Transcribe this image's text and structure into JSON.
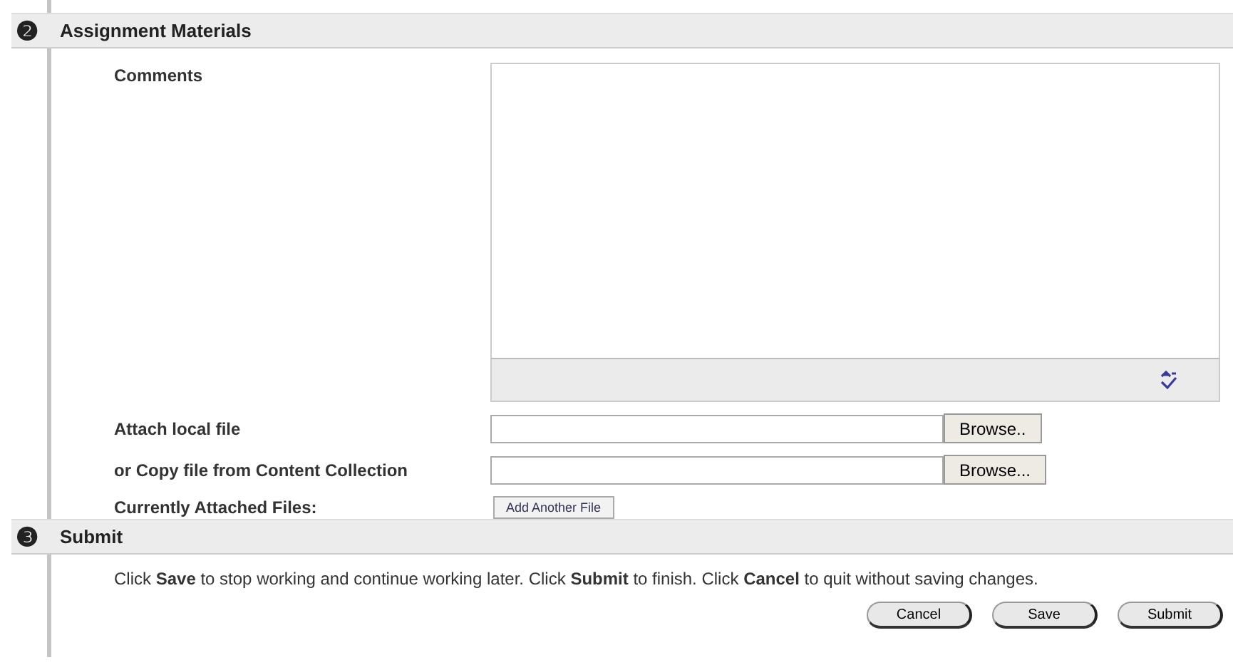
{
  "sections": [
    {
      "number": "❷",
      "title": "Assignment Materials"
    },
    {
      "number": "❸",
      "title": "Submit"
    }
  ],
  "comments": {
    "label": "Comments"
  },
  "attach_rows": [
    {
      "label": "Attach local file",
      "button": "Browse.."
    },
    {
      "label": "or Copy file from Content Collection",
      "button": "Browse..."
    }
  ],
  "attached": {
    "label": "Currently Attached Files:",
    "button": "Add Another File"
  },
  "instructions": "Click **Save** to stop working and continue working later. Click **Submit** to finish. Click **Cancel** to quit without saving changes.",
  "buttons": [
    "Cancel",
    "Save",
    "Submit"
  ]
}
